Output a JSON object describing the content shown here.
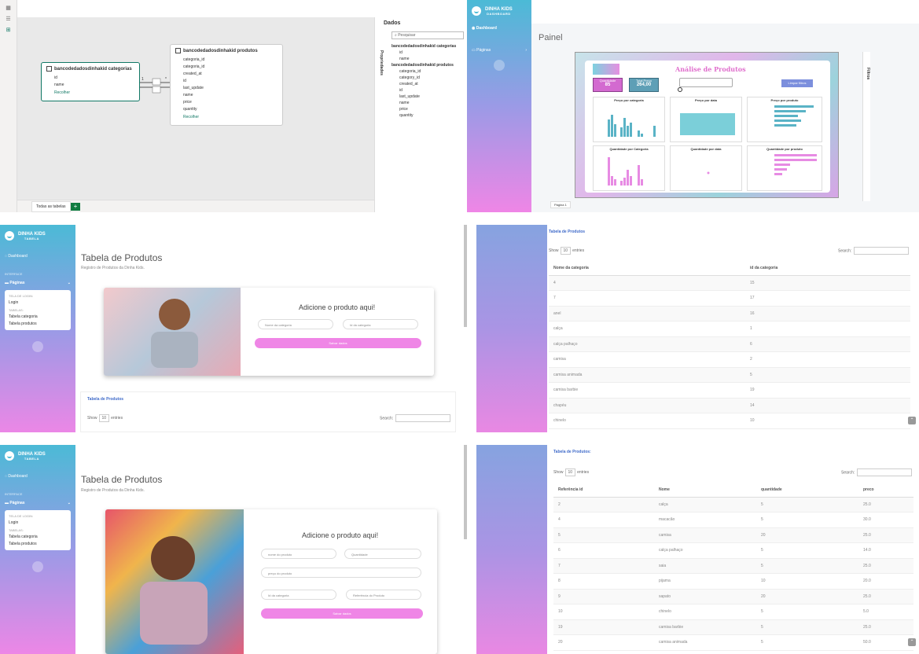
{
  "model": {
    "categorias_table": {
      "title": "bancodedadosdinhakid categorias",
      "fields": [
        "id",
        "name"
      ],
      "collapse": "Recolher"
    },
    "produtos_table": {
      "title": "bancodedadosdinhakid produtos",
      "fields": [
        "categoria_id",
        "categoria_id",
        "created_at",
        "id",
        "last_update",
        "name",
        "price",
        "quantity"
      ],
      "collapse": "Recolher"
    },
    "relation": {
      "left": "1",
      "right": "*"
    },
    "tabs": {
      "all": "Todas as tabelas",
      "add": "+"
    },
    "pane": {
      "title": "Dados",
      "properties": "Propriedades",
      "search_placeholder": "Pesquisar",
      "group1": "bancodedadosdinhakid categorias",
      "group1_fields": [
        "id",
        "name"
      ],
      "group2": "bancodedadosdinhakid produtos",
      "group2_fields": [
        "categoria_id",
        "category_id",
        "created_at",
        "id",
        "last_update",
        "name",
        "price",
        "quantity"
      ]
    }
  },
  "dashboard": {
    "brand_title": "DINHA KIDS",
    "brand_sub": "DASHBOARD",
    "nav_dashboard": "Dashboard",
    "nav_pages": "Páginas",
    "page_title": "Painel",
    "report_title": "Análise de Produtos",
    "kpi1_label": "Quantidade",
    "kpi1_value": "85",
    "kpi2_label": "Total Preço",
    "kpi2_value": "264,00",
    "filter_label": "Limpar filtros",
    "chart_titles": [
      "Preço por categoria",
      "Preço por data",
      "Preço por produto",
      "Quantidade por Categoria",
      "Quantidade por data",
      "Quantidade por produto"
    ],
    "filters_pane": "Filtros",
    "page_tab": "Página 1",
    "colors": {
      "teal": "#5ab3c6",
      "pink": "#e78be3",
      "cyan": "#7bcfd9"
    }
  },
  "tabela_cat": {
    "brand_title": "DINHA KIDS",
    "brand_sub": "TABELA",
    "nav_dashboard": "Dashboard",
    "interface": "INTERFACE",
    "nav_pages": "Páginas",
    "menu": {
      "cap1": "TELA DE LOGIN:",
      "login": "Login",
      "cap2": "TABELAS:",
      "t1": "Tabela categoria",
      "t2": "Tabela produtos"
    },
    "page_title": "Tabela de Produtos",
    "page_sub": "Registro de Produtos da Dinha Kids.",
    "form_title": "Adicione o produto aqui!",
    "inp1": "Nome da categoria",
    "inp2": "Id da categoria",
    "save": "Salvar dados",
    "table_head": "Tabela de Produtos",
    "show": "Show",
    "show_val": "10",
    "entries": "entries",
    "search": "Search:"
  },
  "cat_table": {
    "title": "Tabela de Produtos",
    "show": "Show",
    "show_val": "10",
    "entries": "entries",
    "search": "Search:",
    "columns": [
      "Nome da categoria",
      "id da categoria"
    ],
    "rows": [
      [
        "4",
        "15"
      ],
      [
        "7",
        "17"
      ],
      [
        "anel",
        "16"
      ],
      [
        "calça",
        "1"
      ],
      [
        "calça palhaço",
        "6"
      ],
      [
        "camisa",
        "2"
      ],
      [
        "camisa animada",
        "5"
      ],
      [
        "camisa barbie",
        "19"
      ],
      [
        "chapéu",
        "14"
      ],
      [
        "chinelo",
        "10"
      ]
    ]
  },
  "tabela_prod": {
    "brand_title": "DINHA KIDS",
    "brand_sub": "TABELA",
    "nav_dashboard": "Dashboard",
    "interface": "INTERFACE",
    "nav_pages": "Páginas",
    "menu": {
      "cap1": "TELA DE LOGIN:",
      "login": "Login",
      "cap2": "TABELAS:",
      "t1": "Tabela categoria",
      "t2": "Tabela produtos"
    },
    "page_title": "Tabela de Produtos",
    "page_sub": "Registro de Produtos da Dinha Kids.",
    "form_title": "Adicione o produto aqui!",
    "inp_name": "nome do produto",
    "inp_qty": "Quantidade",
    "inp_price": "preço do produto",
    "inp_cat": "Id da categoria",
    "inp_ref": "Referência do Produto",
    "save": "Salvar dados"
  },
  "prod_table": {
    "title": "Tabela de Produtos:",
    "show": "Show",
    "show_val": "10",
    "entries": "entries",
    "search": "Search:",
    "columns": [
      "Referência id",
      "Nome",
      "quantidade",
      "preco"
    ],
    "rows": [
      [
        "2",
        "calça",
        "5",
        "25.0"
      ],
      [
        "4",
        "macacão",
        "5",
        "30.0"
      ],
      [
        "5",
        "camisa",
        "20",
        "25.0"
      ],
      [
        "6",
        "calça palhaço",
        "5",
        "14.0"
      ],
      [
        "7",
        "saia",
        "5",
        "25.0"
      ],
      [
        "8",
        "pijama",
        "10",
        "20.0"
      ],
      [
        "9",
        "sapato",
        "20",
        "25.0"
      ],
      [
        "10",
        "chinelo",
        "5",
        "5.0"
      ],
      [
        "19",
        "camisa barbie",
        "5",
        "25.0"
      ],
      [
        "20",
        "camisa animada",
        "5",
        "50.0"
      ]
    ]
  }
}
